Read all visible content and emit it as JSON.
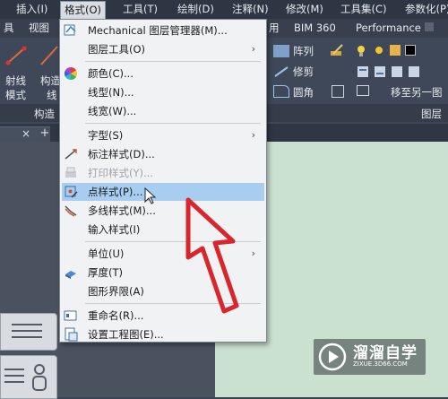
{
  "menubar": {
    "items": [
      {
        "label": "插入(I)"
      },
      {
        "label": "格式(O)"
      },
      {
        "label": "工具(T)"
      },
      {
        "label": "绘制(D)"
      },
      {
        "label": "注释(N)"
      },
      {
        "label": "修改(M)"
      },
      {
        "label": "工具集(C)"
      },
      {
        "label": "参数化(P)"
      }
    ]
  },
  "ribbon_tabs": {
    "items": [
      {
        "label": "具"
      },
      {
        "label": "视图"
      },
      {
        "label": "用"
      },
      {
        "label": "BIM 360"
      },
      {
        "label": "Performance"
      }
    ]
  },
  "ribbon": {
    "ray_label_1": "射线",
    "ray_label_2": "模式",
    "construct_label_1": "构造",
    "construct_label_2": "线",
    "panel_construct": "构造",
    "array_label": "阵列",
    "trim_label": "修剪",
    "fillet_label": "圆角",
    "move_to_layer_label": "移至另一图",
    "panel_layer": "图层"
  },
  "menu": {
    "items": [
      {
        "label": "Mechanical 图层管理器(M)...",
        "icon": "layer-manager-icon",
        "enabled": true
      },
      {
        "label": "图层工具(O)",
        "icon": "",
        "enabled": true,
        "submenu": true
      },
      {
        "label": "颜色(C)...",
        "icon": "color-wheel-icon",
        "enabled": true
      },
      {
        "label": "线型(N)...",
        "icon": "",
        "enabled": true
      },
      {
        "label": "线宽(W)...",
        "icon": "",
        "enabled": true
      },
      {
        "label": "字型(S)",
        "icon": "",
        "enabled": true,
        "submenu": true
      },
      {
        "label": "标注样式(D)...",
        "icon": "dimension-style-icon",
        "enabled": true
      },
      {
        "label": "打印样式(Y)...",
        "icon": "print-style-icon",
        "enabled": false
      },
      {
        "label": "点样式(P)...",
        "icon": "point-style-icon",
        "enabled": true,
        "highlighted": true
      },
      {
        "label": "多线样式(M)...",
        "icon": "multiline-style-icon",
        "enabled": true
      },
      {
        "label": "输入样式(I)",
        "icon": "",
        "enabled": true
      },
      {
        "label": "单位(U)",
        "icon": "",
        "enabled": true,
        "submenu": true
      },
      {
        "label": "厚度(T)",
        "icon": "thickness-icon",
        "enabled": true
      },
      {
        "label": "图形界限(A)",
        "icon": "",
        "enabled": true
      },
      {
        "label": "重命名(R)...",
        "icon": "rename-icon",
        "enabled": true
      },
      {
        "label": "设置工程图(E)...",
        "icon": "setup-drawing-icon",
        "enabled": true
      }
    ],
    "submenu_arrow": "›"
  },
  "doc_tab": {
    "close": "×",
    "add": "+"
  },
  "watermark": {
    "title": "溜溜自学",
    "subtitle": "ZIXUE.3D66.COM"
  },
  "colors": {
    "accent_highlight": "#a7cdf0",
    "annotation_arrow": "#d8262c",
    "canvas": "#cbe1cf"
  }
}
